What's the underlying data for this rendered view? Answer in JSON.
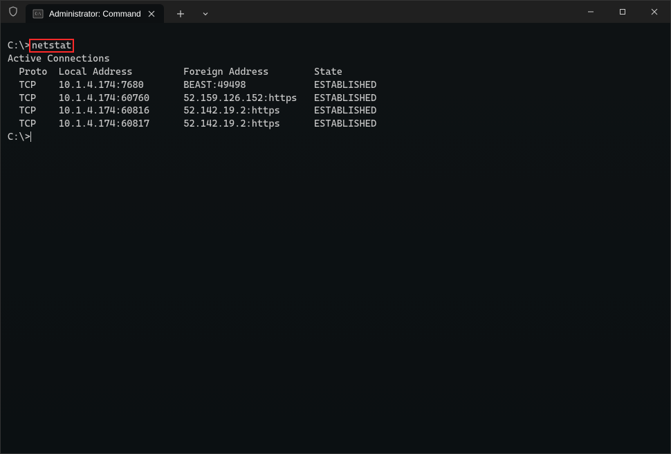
{
  "titlebar": {
    "tab_title": "Administrator: Command Prom",
    "close_glyph": "✕",
    "plus_glyph": "+",
    "chevron_glyph": "⌄",
    "min_glyph": "—",
    "max_glyph": "▢",
    "winclose_glyph": "✕"
  },
  "terminal": {
    "prompt1_dir": "C:\\>",
    "prompt1_cmd": "netstat",
    "blank": "",
    "header": "Active Connections",
    "columns": {
      "proto": "Proto",
      "local": "Local Address",
      "foreign": "Foreign Address",
      "state": "State"
    },
    "rows": [
      {
        "proto": "TCP",
        "local": "10.1.4.174:7680",
        "foreign": "BEAST:49498",
        "state": "ESTABLISHED"
      },
      {
        "proto": "TCP",
        "local": "10.1.4.174:60760",
        "foreign": "52.159.126.152:https",
        "state": "ESTABLISHED"
      },
      {
        "proto": "TCP",
        "local": "10.1.4.174:60816",
        "foreign": "52.142.19.2:https",
        "state": "ESTABLISHED"
      },
      {
        "proto": "TCP",
        "local": "10.1.4.174:60817",
        "foreign": "52.142.19.2:https",
        "state": "ESTABLISHED"
      }
    ],
    "prompt2_dir": "C:\\>"
  }
}
